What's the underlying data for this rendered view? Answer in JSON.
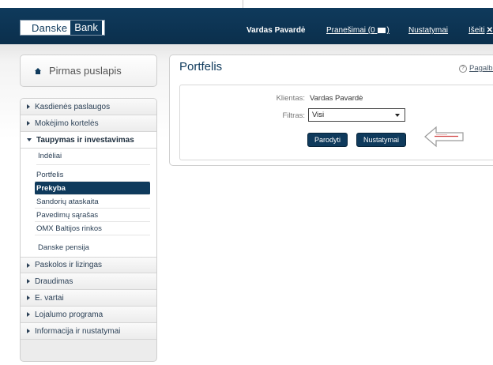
{
  "header": {
    "logo_part1": "Danske",
    "logo_part2": "Bank",
    "user_name": "Vardas Pavardė",
    "messages_label": "Pranešimai (0",
    "messages_close": ")",
    "settings_label": "Nustatymai",
    "logout_label": "Išeiti",
    "logout_x": "✕"
  },
  "home": {
    "label": "Pirmas puslapis"
  },
  "menu": {
    "items_top": [
      {
        "label": "Kasdienės paslaugos"
      },
      {
        "label": "Mokėjimo kortelės"
      }
    ],
    "open_item": {
      "label": "Taupymas ir investavimas"
    },
    "sub_1": {
      "label": "Indėliai"
    },
    "sub_group_items": [
      {
        "label": "Portfelis"
      },
      {
        "label": "Prekyba"
      },
      {
        "label": "Sandorių ataskaita"
      },
      {
        "label": "Pavedimų sąrašas"
      },
      {
        "label": "OMX Baltijos rinkos"
      }
    ],
    "sub_2": {
      "label": "Danske pensija"
    },
    "items_bottom": [
      {
        "label": "Paskolos ir lizingas"
      },
      {
        "label": "Draudimas"
      },
      {
        "label": "E. vartai"
      },
      {
        "label": "Lojalumo programa"
      },
      {
        "label": "Informacija ir nustatymai"
      }
    ]
  },
  "main": {
    "title": "Portfelis",
    "help_label": "Pagalba",
    "client_label": "Klientas:",
    "client_value": "Vardas Pavardė",
    "filter_label": "Filtras:",
    "filter_selected": "Visi",
    "show_button": "Parodyti",
    "settings_button": "Nustatymai"
  },
  "colors": {
    "brand_navy": "#0f3a5c",
    "hint_arrow": "#d04040"
  }
}
